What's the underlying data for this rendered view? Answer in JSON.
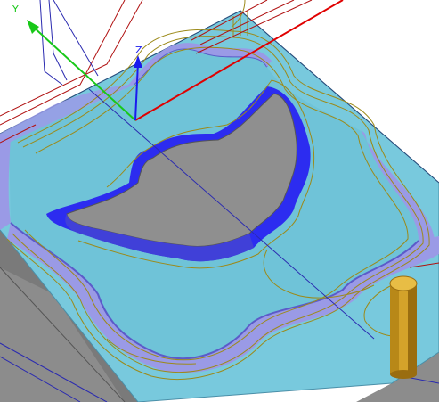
{
  "viewport": {
    "background": "#ffffff"
  },
  "axes": {
    "x": {
      "label": "",
      "color": "#e00000"
    },
    "y": {
      "label": "Y",
      "color": "#18c818"
    },
    "z": {
      "label": "Z",
      "color": "#1a1aee"
    }
  },
  "colors": {
    "stock_top": "#78c9dd",
    "wall_face": "#9a9ae6",
    "wall_dark": "#5b5bc9",
    "floor_base": "#8c8c8c",
    "island_top": "#8f8f8f",
    "island_rim": "#2c2cf0",
    "toolpath": "#9c8a1a",
    "rapid_lines": "#b01010",
    "link_lines": "#2a2ab0",
    "tool_body": "#d4a22a",
    "tool_shade": "#9a6d10"
  },
  "objects": [
    {
      "name": "stock-block"
    },
    {
      "name": "pocket-walls"
    },
    {
      "name": "island"
    },
    {
      "name": "toolpaths"
    },
    {
      "name": "cutting-tool"
    }
  ]
}
